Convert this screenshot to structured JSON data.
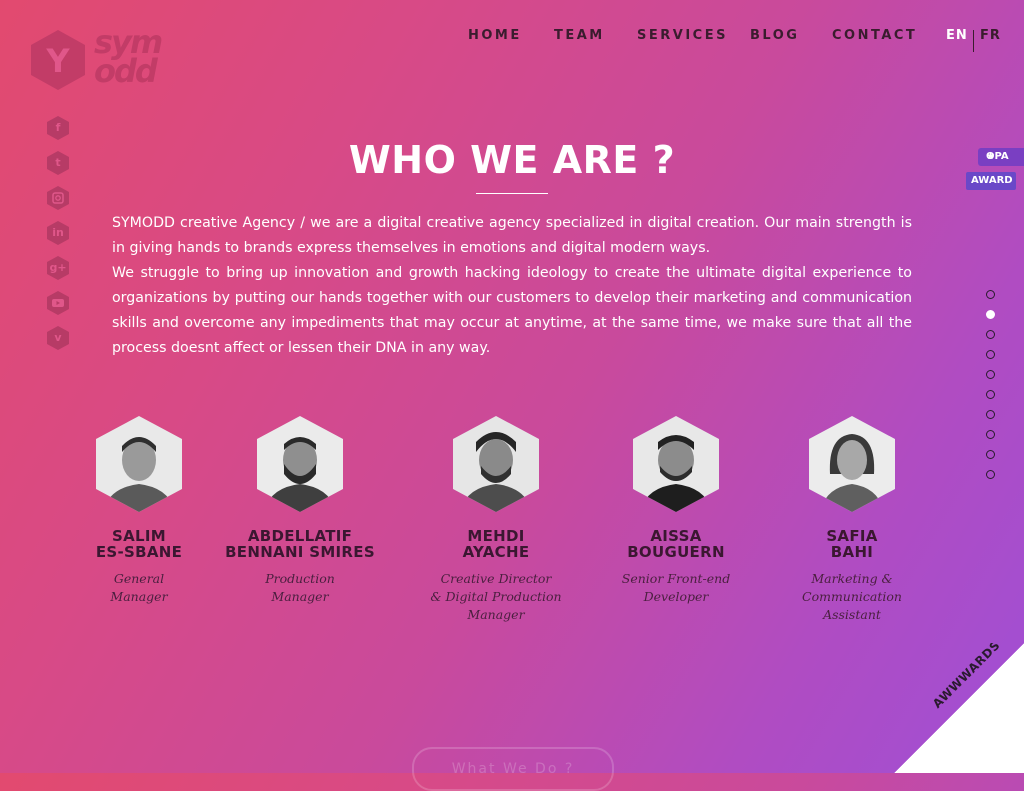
{
  "brand": {
    "logo_letter": "Y",
    "logo_top": "sym",
    "logo_bottom": "odd"
  },
  "nav": {
    "items": [
      "HOME",
      "TEAM",
      "SERVICES",
      "BLOG",
      "CONTACT"
    ]
  },
  "lang": {
    "active": "EN",
    "other": "FR"
  },
  "social": [
    "f",
    "t",
    "in",
    "in",
    "g+",
    "yt",
    "v"
  ],
  "social_icons": [
    "facebook-icon",
    "twitter-icon",
    "instagram-icon",
    "linkedin-icon",
    "google-plus-icon",
    "youtube-icon",
    "vimeo-icon"
  ],
  "section": {
    "title": "WHO WE ARE ?",
    "paragraphs": [
      "SYMODD creative Agency / we are a digital creative agency specialized in digital creation. Our main strength is in giving hands to brands express themselves in emotions and digital modern ways.",
      "We struggle to bring up innovation and growth hacking ideology to create the ultimate digital experience to organizations by putting our hands together with our customers to develop their marketing and communication skills and overcome any impediments that may occur at anytime, at the same time, we make sure that all the process doesnt affect or lessen their DNA in any way."
    ]
  },
  "award": {
    "opa": "OPA",
    "label": "AWARD"
  },
  "pager": {
    "count": 10,
    "active_index": 1
  },
  "team": [
    {
      "first": "SALIM",
      "last": "ES-SBANE",
      "role_1": "General",
      "role_2": "Manager"
    },
    {
      "first": "ABDELLATIF",
      "last": "BENNANI SMIRES",
      "role_1": "Production",
      "role_2": "Manager"
    },
    {
      "first": "MEHDI",
      "last": "AYACHE",
      "role_1": "Creative Director",
      "role_2": "& Digital Production Manager"
    },
    {
      "first": "AISSA",
      "last": "BOUGUERN",
      "role_1": "Senior Front-end",
      "role_2": "Developer"
    },
    {
      "first": "SAFIA",
      "last": "BAHI",
      "role_1": "Marketing & Communication",
      "role_2": "Assistant"
    }
  ],
  "next_button": "What We Do ?",
  "badge": "AWWWARDS © H.M",
  "colors": {
    "bg_start": "#e24a6f",
    "bg_end": "#9f4fd6",
    "dark_text": "#3a1c2e"
  }
}
